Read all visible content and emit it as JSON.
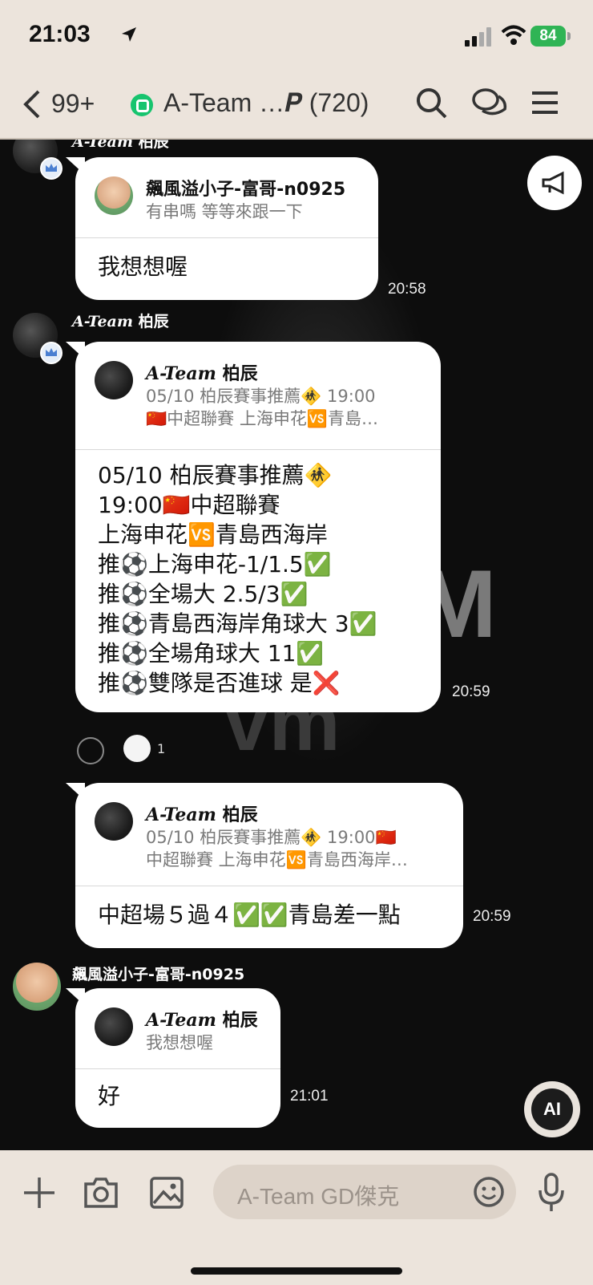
{
  "status_bar": {
    "time": "21:03",
    "battery": "84"
  },
  "nav": {
    "back_count": "99+",
    "title": "A-Team …𝑷 (720)"
  },
  "messages": [
    {
      "sender_plain": "柏辰",
      "sender_italic": "A-Team",
      "reply_name": "飆風溢小子-富哥-n0925",
      "reply_text": "有串嗎 等等來跟一下",
      "body": "我想想喔",
      "time": "20:58"
    },
    {
      "sender_plain": "柏辰",
      "sender_italic": "A-Team",
      "reply_name_italic": "A-Team",
      "reply_name_plain": "柏辰",
      "reply_text": "05/10 柏辰賽事推薦🚸 19:00\n🇨🇳中超聯賽 上海申花🆚青島…",
      "body": "05/10 柏辰賽事推薦🚸\n19:00🇨🇳中超聯賽\n上海申花🆚青島西海岸\n推⚽上海申花-1/1.5✅\n推⚽全場大 2.5/3✅\n推⚽青島西海岸角球大 3✅\n推⚽全場角球大 11✅\n推⚽雙隊是否進球 是❌",
      "time": "20:59",
      "reaction_count": "1"
    },
    {
      "reply_name_italic": "A-Team",
      "reply_name_plain": "柏辰",
      "reply_text": "05/10 柏辰賽事推薦🚸 19:00🇨🇳\n中超聯賽 上海申花🆚青島西海岸…",
      "body": "中超場５過４✅✅青島差一點",
      "time": "20:59"
    },
    {
      "sender": "飆風溢小子-富哥-n0925",
      "reply_name_italic": "A-Team",
      "reply_name_plain": "柏辰",
      "reply_text": "我想想喔",
      "body": "好",
      "time": "21:01"
    }
  ],
  "floating": {
    "ai_label": "AI"
  },
  "input": {
    "placeholder": "A-Team GD傑克"
  },
  "background": {
    "letter1": "M",
    "letter2": "vm"
  }
}
